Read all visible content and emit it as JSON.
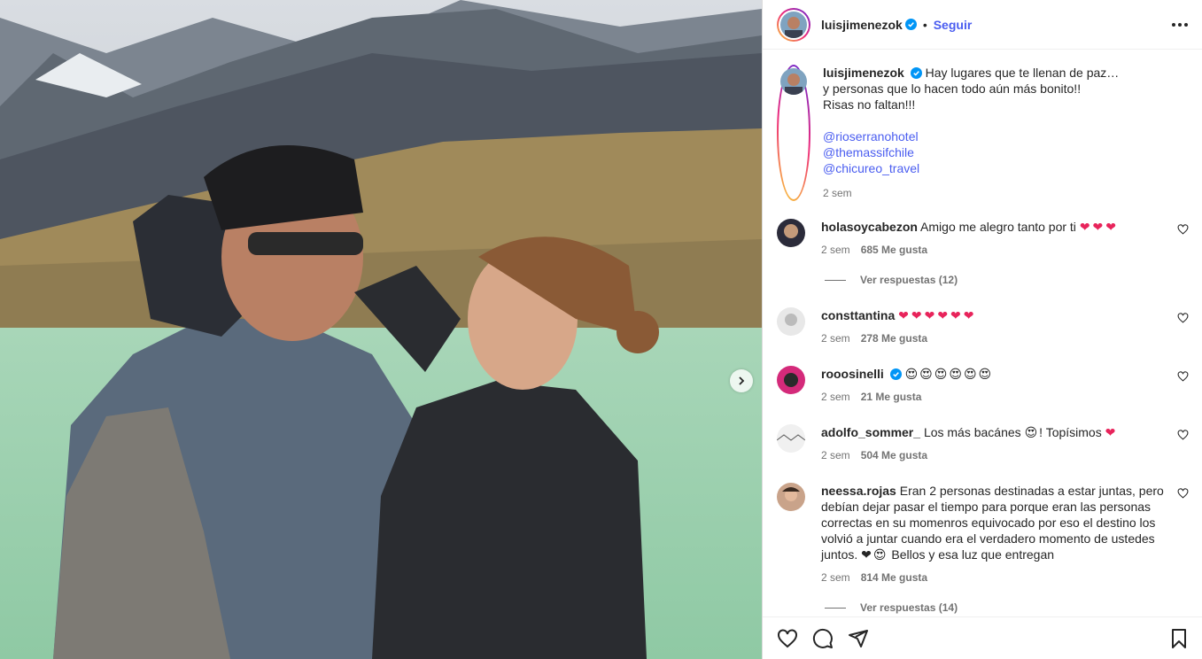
{
  "post": {
    "author": "luisjimenezok",
    "follow_label": "Seguir",
    "dot": "•",
    "caption_lines": [
      "Hay lugares que te llenan de paz…",
      "y personas que lo hacen todo aún más bonito!!",
      "Risas no faltan!!!"
    ],
    "mentions": [
      "@rioserranohotel",
      "@themassifchile",
      "@chicureo_travel"
    ],
    "time": "2 sem"
  },
  "comments": [
    {
      "user": "holasoycabezon",
      "text": "Amigo me alegro tanto por ti",
      "emoji": "❤❤❤",
      "time": "2 sem",
      "likes": "685 Me gusta",
      "replies": "Ver respuestas (12)"
    },
    {
      "user": "consttantina",
      "text": "",
      "emoji": "❤❤❤❤❤❤",
      "time": "2 sem",
      "likes": "278 Me gusta"
    },
    {
      "user": "rooosinelli",
      "text": "",
      "emoji": "😍😍😍😍😍😍",
      "time": "2 sem",
      "likes": "21 Me gusta",
      "verified": true
    },
    {
      "user": "adolfo_sommer_",
      "text": "Los más bacánes",
      "emoji1": "😍",
      "text2": "! Topísimos",
      "emoji2": "❤",
      "time": "2 sem",
      "likes": "504 Me gusta"
    },
    {
      "user": "neessa.rojas",
      "text": "Eran 2 personas destinadas a estar juntas, pero debían dejar pasar el tiempo para porque eran las personas correctas en su momenros equivocado por eso el destino los volvió a juntar cuando era el verdadero momento de ustedes juntos.",
      "emoji": "❤😍",
      "text2": "Bellos y esa luz que entregan",
      "time": "2 sem",
      "likes": "814 Me gusta",
      "replies": "Ver respuestas (14)"
    }
  ],
  "icons": [
    "heart-icon",
    "comment-icon",
    "share-icon",
    "bookmark-icon",
    "more-icon",
    "chevron-right-icon",
    "verified-icon"
  ],
  "colors": {
    "link": "#4a5df0",
    "verified": "#0095f6",
    "heart": "#e8245b"
  }
}
